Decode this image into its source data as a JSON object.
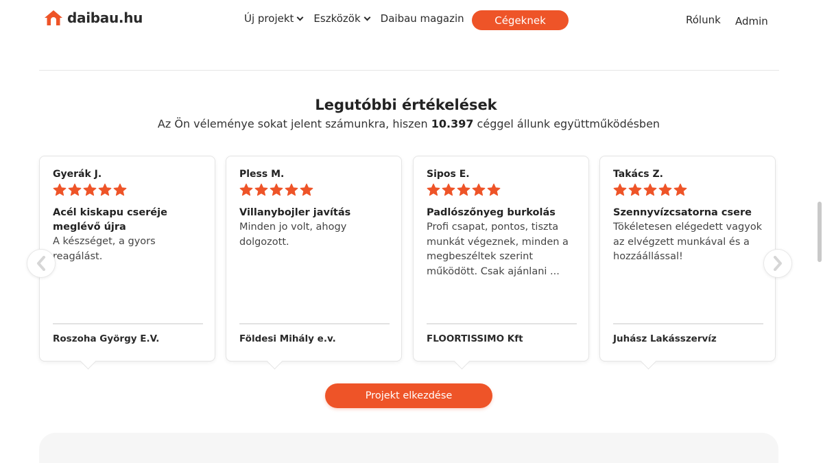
{
  "header": {
    "logo_text": "daibau.hu",
    "nav": [
      {
        "label": "Új projekt",
        "dropdown": true
      },
      {
        "label": "Eszközök",
        "dropdown": true
      },
      {
        "label": "Daibau magazin",
        "dropdown": false
      }
    ],
    "cta_label": "Cégeknek",
    "right_links": [
      "Rólunk",
      "Admin"
    ]
  },
  "section": {
    "title": "Legutóbbi értékelések",
    "subtitle_before": "Az Ön véleménye sokat jelent számunkra, hiszen ",
    "subtitle_count": "10.397",
    "subtitle_after": " céggel állunk együttműködésben"
  },
  "reviews": [
    {
      "reviewer": "Gyerák J.",
      "rating": 5,
      "title": "Acél kiskapu cseréje meglévő újra",
      "text": "A készséget, a gyors reagálást.",
      "company": "Roszoha György E.V."
    },
    {
      "reviewer": "Pless M.",
      "rating": 5,
      "title": "Villanybojler javítás",
      "text": "Minden jo volt, ahogy dolgozott.",
      "company": "Földesi Mihály e.v."
    },
    {
      "reviewer": "Sipos E.",
      "rating": 5,
      "title": "Padlószőnyeg burkolás",
      "text": "Profi csapat, pontos, tiszta munkát végeznek, minden a megbeszéltek szerint működött. Csak ajánlani ...",
      "company": "FLOORTISSIMO Kft"
    },
    {
      "reviewer": "Takács Z.",
      "rating": 5,
      "title": "Szennyvízcsatorna csere",
      "text": "Tökéletesen elégedett vagyok az elvégzett munkával és a hozzáállással!",
      "company": "Juhász Lakásszervíz"
    }
  ],
  "carousel": {
    "prev_icon": "chevron-left-icon",
    "next_icon": "chevron-right-icon"
  },
  "main_cta_label": "Projekt elkezdése",
  "colors": {
    "accent": "#ee5428",
    "star": "#ee5428"
  }
}
